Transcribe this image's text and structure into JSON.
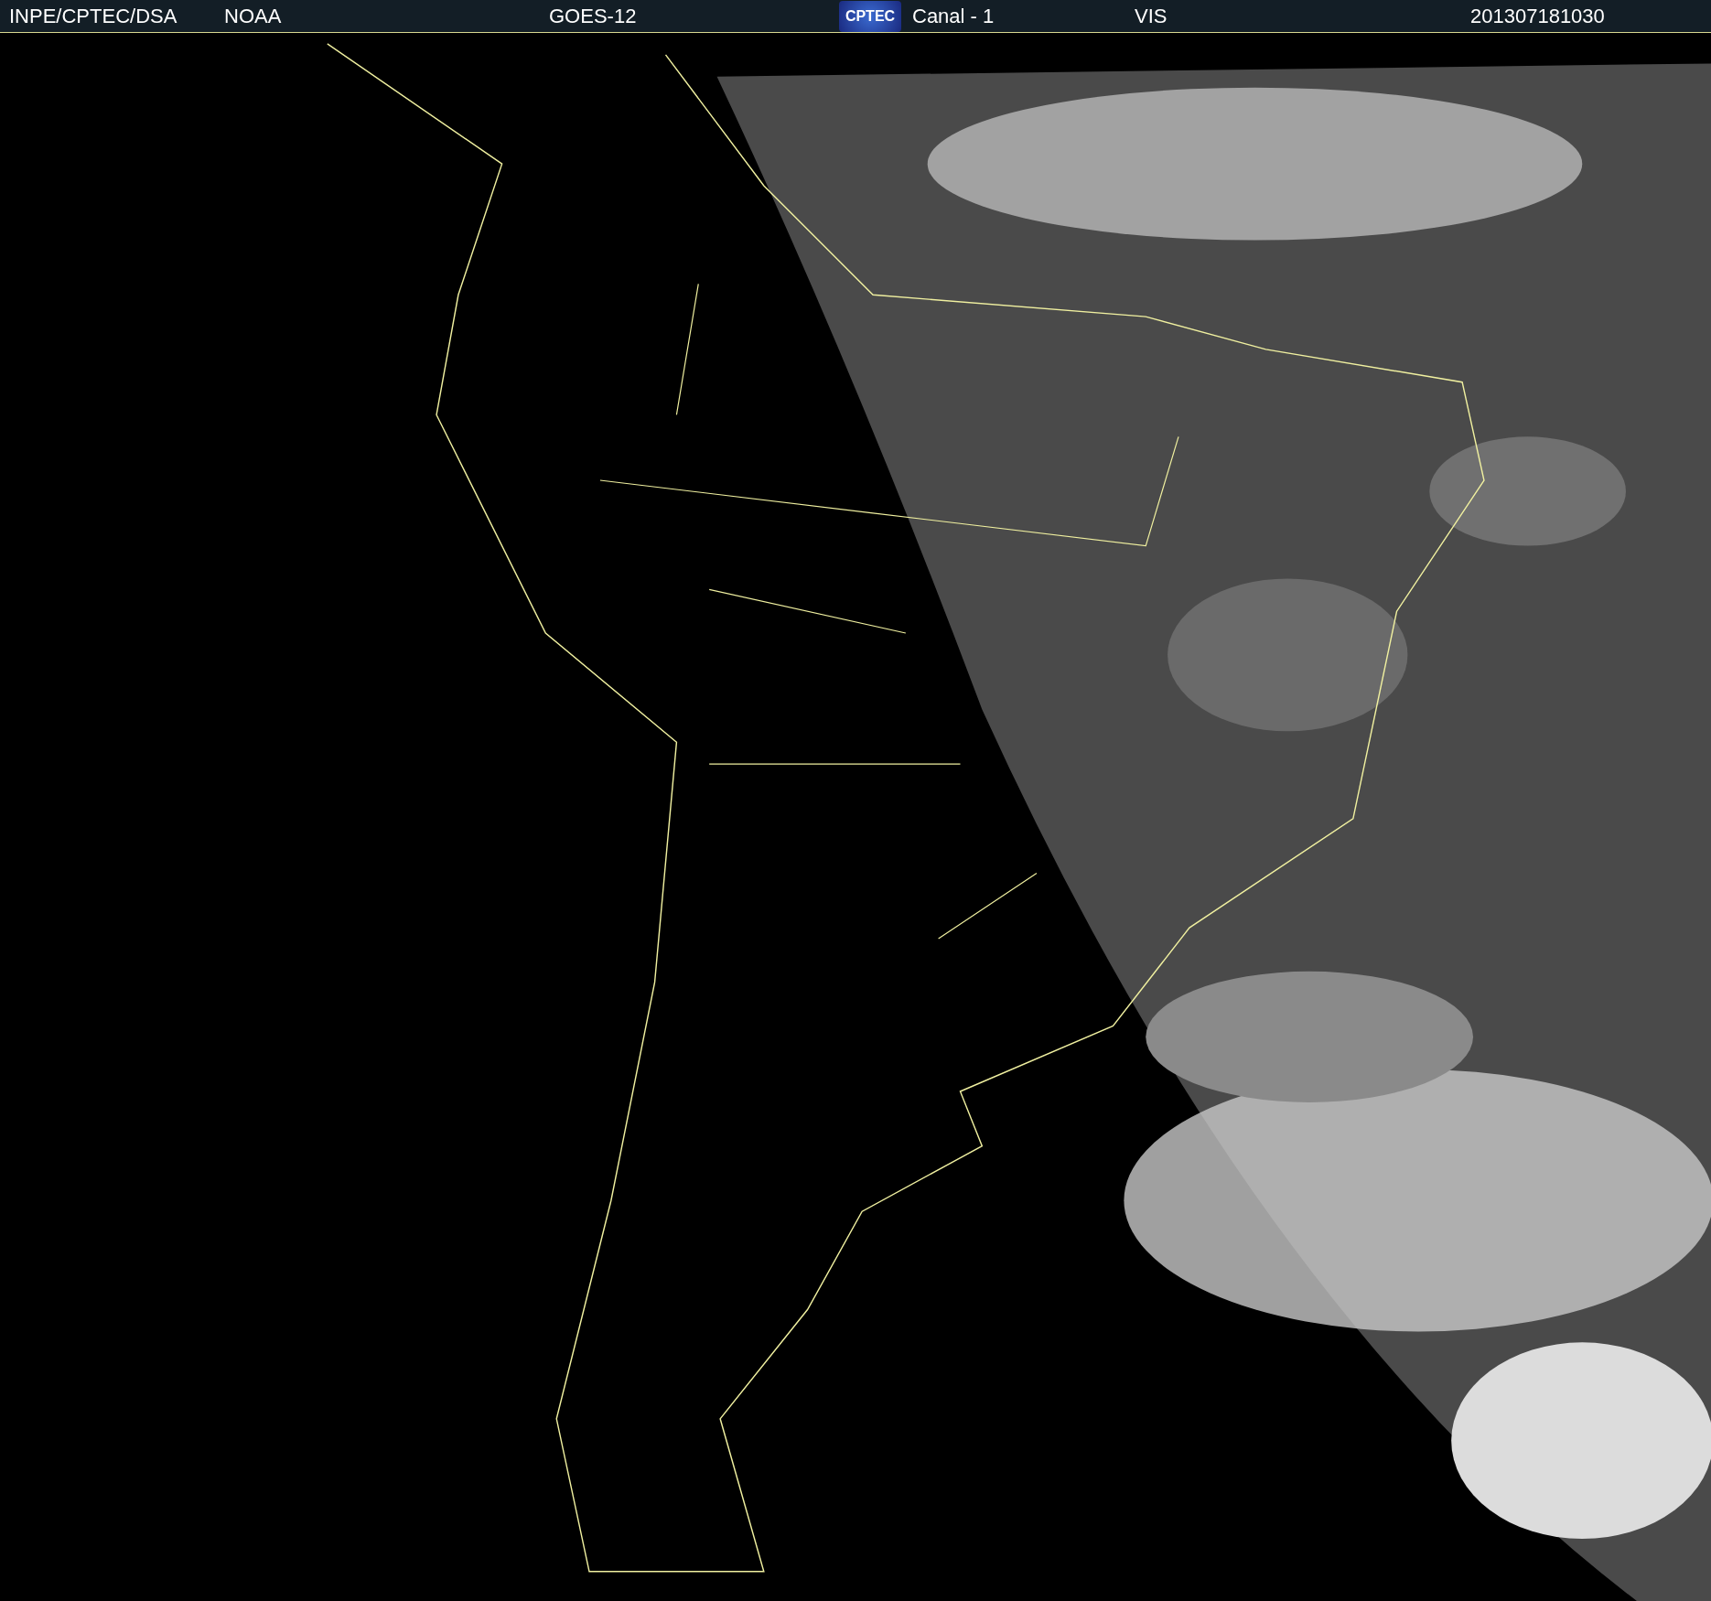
{
  "header": {
    "institution": "INPE/CPTEC/DSA",
    "agency": "NOAA",
    "satellite": "GOES-12",
    "logo_text": "CPTEC",
    "channel": "Canal - 1",
    "band": "VIS",
    "timestamp": "201307181030"
  }
}
